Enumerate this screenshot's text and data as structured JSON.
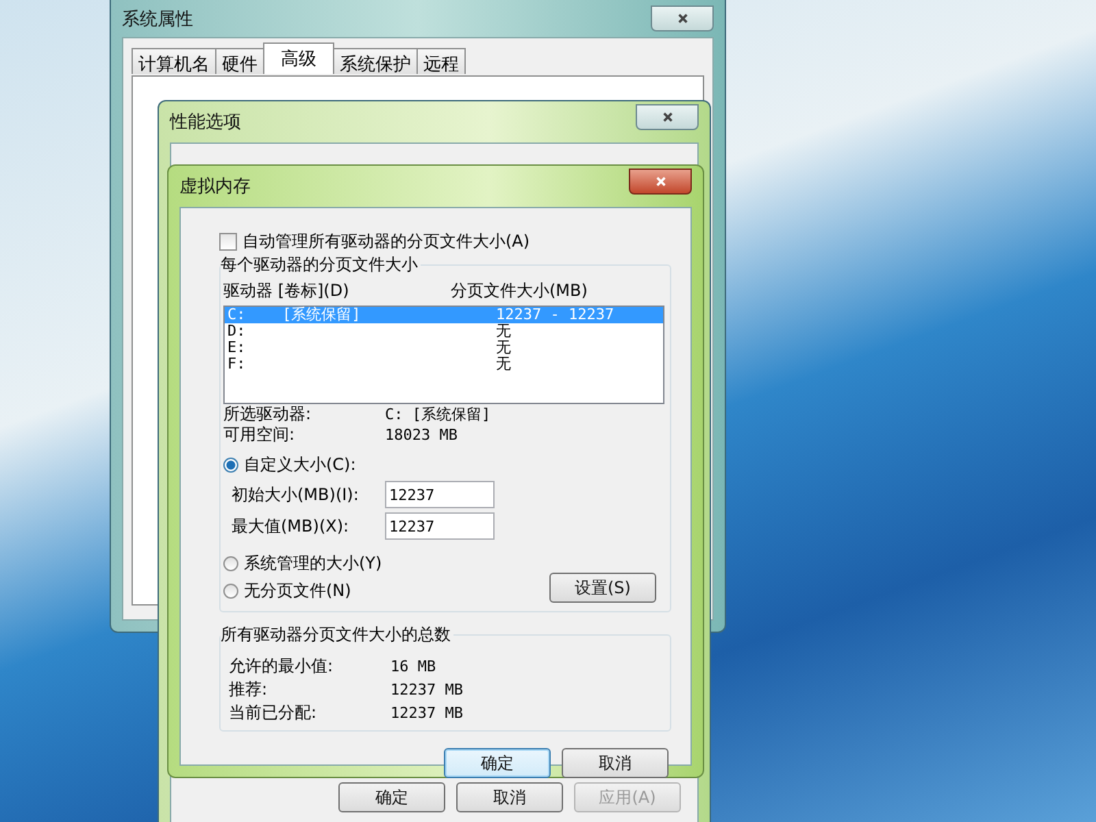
{
  "system_properties": {
    "title": "系统属性",
    "tabs": [
      {
        "label": "计算机名",
        "selected": false
      },
      {
        "label": "硬件",
        "selected": false
      },
      {
        "label": "高级",
        "selected": true
      },
      {
        "label": "系统保护",
        "selected": false
      },
      {
        "label": "远程",
        "selected": false
      }
    ]
  },
  "performance_options": {
    "title": "性能选项",
    "buttons": [
      {
        "label": "确定",
        "disabled": false
      },
      {
        "label": "取消",
        "disabled": false
      },
      {
        "label": "应用(A)",
        "disabled": true
      }
    ]
  },
  "virtual_memory": {
    "title": "虚拟内存",
    "auto_manage": {
      "label": "自动管理所有驱动器的分页文件大小(A)",
      "checked": false
    },
    "drives_group": {
      "title": "每个驱动器的分页文件大小",
      "column_1": "驱动器 [卷标](D)",
      "column_2": "分页文件大小(MB)",
      "drives": [
        {
          "drive": "C:",
          "volume": "[系统保留]",
          "size": "12237 - 12237",
          "selected": true
        },
        {
          "drive": "D:",
          "size": "无",
          "selected": false
        },
        {
          "drive": "E:",
          "size": "无",
          "selected": false
        },
        {
          "drive": "F:",
          "size": "无",
          "selected": false
        }
      ],
      "info": [
        {
          "label": "所选驱动器:",
          "value": "C:  [系统保留]"
        },
        {
          "label": "可用空间:",
          "value": "18023 MB"
        }
      ],
      "custom_size": {
        "label": "自定义大小(C):",
        "selected": true
      },
      "fields": [
        {
          "label": "初始大小(MB)(I):",
          "value": "12237"
        },
        {
          "label": "最大值(MB)(X):",
          "value": "12237"
        }
      ],
      "other_options": [
        {
          "label": "系统管理的大小(Y)",
          "selected": false
        },
        {
          "label": "无分页文件(N)",
          "selected": false
        }
      ],
      "set_button": "设置(S)"
    },
    "totals_group": {
      "title": "所有驱动器分页文件大小的总数",
      "rows": [
        {
          "label": "允许的最小值:",
          "value": "16 MB"
        },
        {
          "label": "推荐:",
          "value": "12237 MB"
        },
        {
          "label": "当前已分配:",
          "value": "12237 MB"
        }
      ]
    },
    "buttons": [
      {
        "label": "确定",
        "default": true
      },
      {
        "label": "取消",
        "default": false
      }
    ]
  }
}
